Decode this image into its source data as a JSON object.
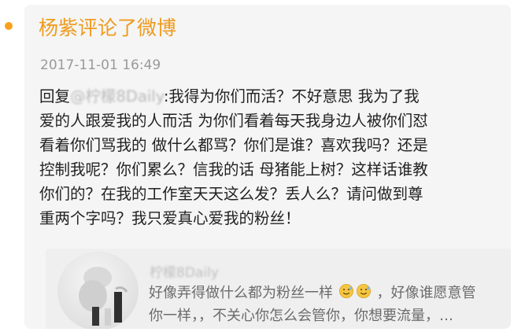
{
  "notification": {
    "title": "杨紫评论了微博",
    "timestamp": "2017-11-01 16:49"
  },
  "reply": {
    "prefix": "回复",
    "mention": "@柠檬8Daily",
    "lines": {
      "0": ":我得为你们而活？不好意思 我为了我",
      "1": "爱的人跟爱我的人而活 为你们看着每天我身边人被你们怼",
      "2": "看着你们骂我的 做什么都骂？你们是谁？喜欢我吗？还是",
      "3": "控制我呢？你们累么？信我的话 母猪能上树？这样话谁教",
      "4": "你们的？在我的工作室天天这么发？丢人么？请问做到尊",
      "5": "重两个字吗？我只爱真心爱我的粉丝！"
    }
  },
  "quoted_post": {
    "author": "柠檬8Daily",
    "line_1_before_emoji": "好像弄得做什么都为粉丝一样",
    "line_1_after_emoji": "，好像谁愿意管",
    "line_2": "你一样，，不关心你怎么会管你，你想要流量，…",
    "emoji_names": [
      "sweat-smile-emoji-icon",
      "sweat-smile-emoji-icon"
    ]
  },
  "colors": {
    "accent": "#ef9b1e",
    "dot": "#f7a11b",
    "card": "#f5f5f5",
    "quote_card": "#efefef",
    "main_text": "#222222",
    "secondary_text": "#9a9a9a"
  }
}
